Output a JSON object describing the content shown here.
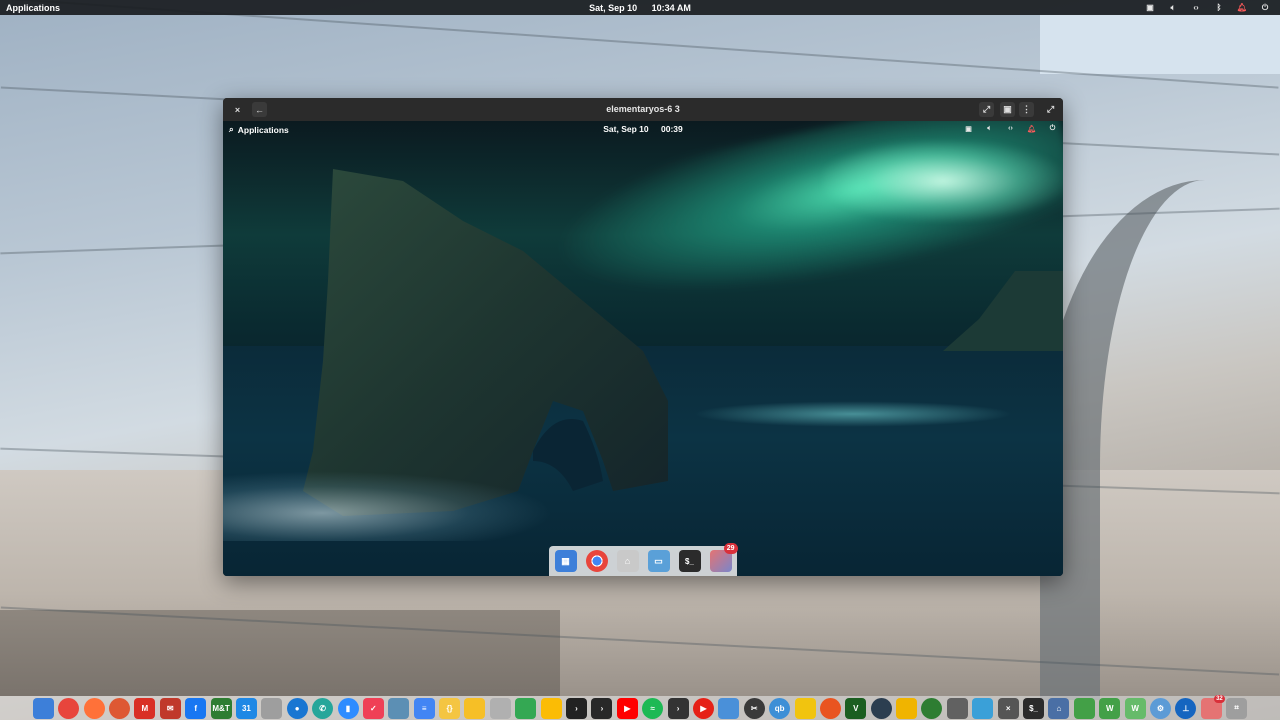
{
  "top_panel": {
    "applications_label": "Applications",
    "date": "Sat, Sep 10",
    "time": "10:34 AM",
    "indicators": [
      "sidebar-icon",
      "volume-icon",
      "network-icon",
      "bluetooth-icon",
      "notification-icon",
      "power-icon"
    ]
  },
  "vm_window": {
    "title": "elementaryos-6 3",
    "buttons": [
      "close-icon",
      "back-icon",
      "fullscreen-icon",
      "screenshot-icon",
      "menu-icon",
      "expand-icon"
    ],
    "glyphs": {
      "close": "×",
      "back": "←",
      "fullscreen": "⤢",
      "screenshot": "▣",
      "menu": "⋮",
      "expand": "⤢"
    }
  },
  "guest": {
    "applications_label": "Applications",
    "date": "Sat, Sep 10",
    "time": "00:39",
    "dock_badge": "29"
  },
  "dock": {
    "apps": [
      {
        "name": "multitasking-view-icon",
        "color": "#3d7fd9"
      },
      {
        "name": "chrome-icon",
        "color": "#e8453c"
      },
      {
        "name": "firefox-icon",
        "color": "#ff7139"
      },
      {
        "name": "duckduckgo-icon",
        "color": "#de5833"
      },
      {
        "name": "gmail-icon",
        "color": "#d93025"
      },
      {
        "name": "mail-icon",
        "color": "#c0392b"
      },
      {
        "name": "facebook-icon",
        "color": "#1877f2"
      },
      {
        "name": "mt-icon",
        "color": "#2e7d32"
      },
      {
        "name": "calendar-icon",
        "color": "#1e88e5"
      },
      {
        "name": "photos-icon",
        "color": "#9e9e9e"
      },
      {
        "name": "contacts-icon",
        "color": "#1976d2"
      },
      {
        "name": "phone-icon",
        "color": "#26a69a"
      },
      {
        "name": "zoom-icon",
        "color": "#2d8cff"
      },
      {
        "name": "pocket-icon",
        "color": "#ef4056"
      },
      {
        "name": "document-viewer-icon",
        "color": "#5c8fb4"
      },
      {
        "name": "docs-icon",
        "color": "#4285f4"
      },
      {
        "name": "code-icon",
        "color": "#f4c542"
      },
      {
        "name": "notes-icon",
        "color": "#f6bf26"
      },
      {
        "name": "files-icon",
        "color": "#b0b0b0"
      },
      {
        "name": "google-drive-icon",
        "color": "#34a853"
      },
      {
        "name": "photos-app-icon",
        "color": "#fbbc05"
      },
      {
        "name": "terminal-prompt-icon",
        "color": "#222222"
      },
      {
        "name": "plex-icon",
        "color": "#282828"
      },
      {
        "name": "youtube-icon",
        "color": "#ff0000"
      },
      {
        "name": "spotify-icon",
        "color": "#1db954"
      },
      {
        "name": "plex-media-icon",
        "color": "#333333"
      },
      {
        "name": "youtube-music-icon",
        "color": "#e62117"
      },
      {
        "name": "screenshot-tool-icon",
        "color": "#4a90d9"
      },
      {
        "name": "tools-icon",
        "color": "#3a3a3a"
      },
      {
        "name": "qbittorrent-icon",
        "color": "#3d8fd6"
      },
      {
        "name": "archive-icon",
        "color": "#f1c40f"
      },
      {
        "name": "ubuntu-tweak-icon",
        "color": "#e95420"
      },
      {
        "name": "vim-icon",
        "color": "#1b5e20"
      },
      {
        "name": "network-icon",
        "color": "#2c3e50"
      },
      {
        "name": "player-icon",
        "color": "#f0b400"
      },
      {
        "name": "game-icon",
        "color": "#2e7d32"
      },
      {
        "name": "keyboard-icon",
        "color": "#616161"
      },
      {
        "name": "clipboard-icon",
        "color": "#3aa0d8"
      },
      {
        "name": "x-terminal-icon",
        "color": "#555555"
      },
      {
        "name": "terminal-icon",
        "color": "#2b2b2b"
      },
      {
        "name": "home-icon",
        "color": "#4a6fa5"
      },
      {
        "name": "cube-icon",
        "color": "#43a047"
      },
      {
        "name": "word-icon",
        "color": "#43a047"
      },
      {
        "name": "w-app-icon",
        "color": "#66bb6a"
      },
      {
        "name": "settings-icon",
        "color": "#5c9bd6"
      },
      {
        "name": "thermometer-icon",
        "color": "#1565c0"
      },
      {
        "name": "calendar-badge-icon",
        "color": "#e57373"
      },
      {
        "name": "screenshot-crop-icon",
        "color": "#9e9e9e"
      }
    ],
    "glyphs": {
      "gmail-icon": "M",
      "mail-icon": "✉",
      "facebook-icon": "f",
      "mt-icon": "M&T",
      "docs-icon": "≡",
      "code-icon": "{}",
      "terminal-prompt-icon": "›",
      "plex-icon": "›",
      "plex-media-icon": "›",
      "youtube-icon": "▶",
      "spotify-icon": "≈",
      "youtube-music-icon": "▶",
      "tools-icon": "✂",
      "qbittorrent-icon": "qb",
      "vim-icon": "V",
      "x-terminal-icon": "×",
      "terminal-icon": "$_",
      "home-icon": "⌂",
      "word-icon": "W",
      "w-app-icon": "W",
      "settings-icon": "⚙",
      "thermometer-icon": "⊥",
      "screenshot-crop-icon": "⌗",
      "phone-icon": "✆",
      "zoom-icon": "▮",
      "calendar-icon": "31",
      "contacts-icon": "●",
      "pocket-icon": "✓"
    },
    "calendar_badge": "32"
  },
  "colors": {
    "panel_bg": "#191c20",
    "vm_header_bg": "#2b2b2b",
    "aurora": "#5affc8",
    "badge_red": "#d9303a"
  }
}
